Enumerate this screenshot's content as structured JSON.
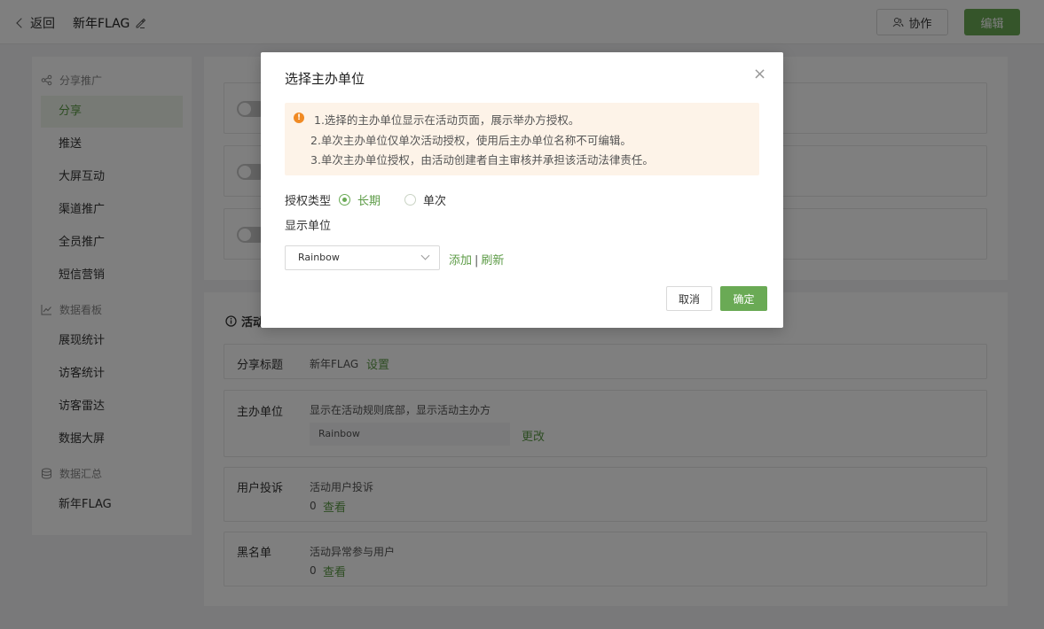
{
  "header": {
    "back_label": "返回",
    "title": "新年FLAG",
    "collab_label": "协作",
    "edit_label": "编辑"
  },
  "sidebar": {
    "groups": [
      {
        "label": "分享推广",
        "icon": "share-icon",
        "items": [
          "分享",
          "推送",
          "大屏互动",
          "渠道推广",
          "全员推广",
          "短信营销"
        ]
      },
      {
        "label": "数据看板",
        "icon": "chart-icon",
        "items": [
          "展现统计",
          "访客统计",
          "访客雷达",
          "数据大屏"
        ]
      },
      {
        "label": "数据汇总",
        "icon": "database-icon",
        "items": [
          "新年FLAG"
        ]
      }
    ],
    "active_item": "分享"
  },
  "main": {
    "section_title_partial": "活动",
    "rows": {
      "share_title": {
        "label": "分享标题",
        "value": "新年FLAG",
        "action": "设置"
      },
      "host": {
        "label": "主办单位",
        "desc": "显示在活动规则底部，显示活动主办方",
        "value": "Rainbow",
        "action": "更改"
      },
      "complaint": {
        "label": "用户投诉",
        "desc": "活动用户投诉",
        "count": "0",
        "action": "查看"
      },
      "blacklist": {
        "label": "黑名单",
        "desc": "活动异常参与用户",
        "count": "0",
        "action": "查看"
      }
    }
  },
  "modal": {
    "title": "选择主办单位",
    "notice": [
      "1.选择的主办单位显示在活动页面，展示举办方授权。",
      "2.单次主办单位仅单次活动授权，使用后主办单位名称不可编辑。",
      "3.单次主办单位授权，由活动创建者自主审核并承担该活动法律责任。"
    ],
    "auth_type_label": "授权类型",
    "auth_options": [
      "长期",
      "单次"
    ],
    "auth_selected": "长期",
    "display_unit_label": "显示单位",
    "select_value": "Rainbow",
    "add_label": "添加",
    "refresh_label": "刷新",
    "cancel_label": "取消",
    "ok_label": "确定"
  },
  "colors": {
    "accent": "#6aaa55",
    "notice_bg": "#fdf3e8",
    "notice_icon": "#f08a24"
  }
}
